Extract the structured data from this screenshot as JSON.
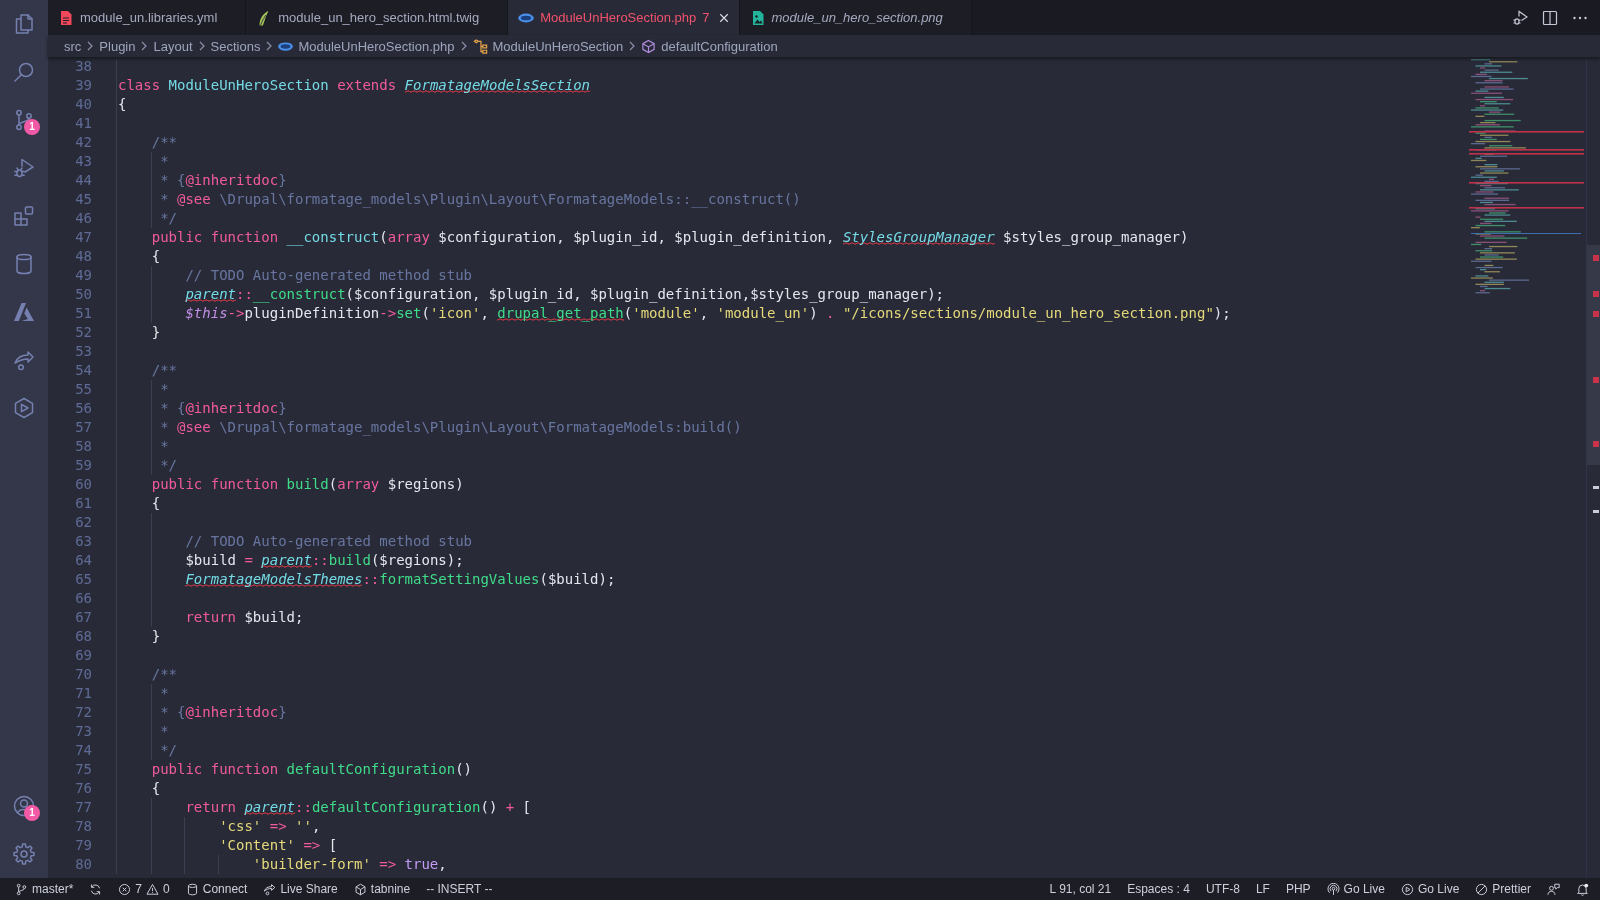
{
  "activity_bar": {
    "items": [
      {
        "kind": "files"
      },
      {
        "kind": "search"
      },
      {
        "kind": "source-control",
        "badge": "1"
      },
      {
        "kind": "run-debug"
      },
      {
        "kind": "extensions"
      },
      {
        "kind": "database"
      },
      {
        "kind": "azure"
      },
      {
        "kind": "live-share"
      },
      {
        "kind": "containers"
      }
    ],
    "bottom_items": [
      {
        "kind": "account",
        "badge": "1"
      },
      {
        "kind": "settings"
      }
    ]
  },
  "tabs": [
    {
      "label": "module_un.libraries.yml",
      "kind": "yaml",
      "selected": false,
      "preview": false
    },
    {
      "label": "module_un_hero_section.html.twig",
      "kind": "twig",
      "selected": false,
      "preview": false
    },
    {
      "label": "ModuleUnHeroSection.php",
      "kind": "php",
      "selected": true,
      "preview": false,
      "problems": "7"
    },
    {
      "label": "module_un_hero_section.png",
      "kind": "image",
      "selected": false,
      "preview": true
    }
  ],
  "breadcrumbs": [
    {
      "label": "src",
      "kind": "folder"
    },
    {
      "label": "Plugin",
      "kind": "folder"
    },
    {
      "label": "Layout",
      "kind": "folder"
    },
    {
      "label": "Sections",
      "kind": "folder"
    },
    {
      "label": "ModuleUnHeroSection.php",
      "kind": "php"
    },
    {
      "label": "ModuleUnHeroSection",
      "kind": "class"
    },
    {
      "label": "defaultConfiguration",
      "kind": "method"
    }
  ],
  "editor": {
    "lines": [
      {
        "number": "38"
      },
      {
        "number": "39",
        "tokens": [
          {
            "text": "class ",
            "kind": "keyword",
            "error": false
          },
          {
            "text": "ModuleUnHeroSection ",
            "kind": "class",
            "error": false
          },
          {
            "text": "extends ",
            "kind": "keyword",
            "error": false
          },
          {
            "text": "FormatageModelsSection",
            "kind": "type",
            "error": true
          }
        ]
      },
      {
        "number": "40",
        "tokens": [
          {
            "text": "{",
            "kind": "plain",
            "error": false
          }
        ]
      },
      {
        "number": "41"
      },
      {
        "number": "42",
        "tokens": [
          {
            "text": "    /**",
            "kind": "comment",
            "error": false
          }
        ]
      },
      {
        "number": "43",
        "tokens": [
          {
            "text": "     *",
            "kind": "comment",
            "error": false
          }
        ]
      },
      {
        "number": "44",
        "tokens": [
          {
            "text": "     * {",
            "kind": "comment",
            "error": false
          },
          {
            "text": "@inheritdoc",
            "kind": "doctag",
            "error": false
          },
          {
            "text": "}",
            "kind": "comment",
            "error": false
          }
        ]
      },
      {
        "number": "45",
        "tokens": [
          {
            "text": "     * ",
            "kind": "comment",
            "error": false
          },
          {
            "text": "@see",
            "kind": "doctag",
            "error": false
          },
          {
            "text": " \\Drupal\\formatage_models\\Plugin\\Layout\\FormatageModels::__construct()",
            "kind": "comment",
            "error": false
          }
        ]
      },
      {
        "number": "46",
        "tokens": [
          {
            "text": "     */",
            "kind": "comment",
            "error": false
          }
        ]
      },
      {
        "number": "47",
        "tokens": [
          {
            "text": "    public function ",
            "kind": "keyword",
            "error": false
          },
          {
            "text": "__construct",
            "kind": "magic",
            "error": false
          },
          {
            "text": "(",
            "kind": "plain",
            "error": false
          },
          {
            "text": "array ",
            "kind": "keyword",
            "error": false
          },
          {
            "text": "$configuration, $plugin_id, $plugin_definition, ",
            "kind": "plain",
            "error": false
          },
          {
            "text": "StylesGroupManager",
            "kind": "type",
            "error": true
          },
          {
            "text": " $styles_group_manager)",
            "kind": "plain",
            "error": false
          }
        ]
      },
      {
        "number": "48",
        "tokens": [
          {
            "text": "    {",
            "kind": "plain",
            "error": false
          }
        ]
      },
      {
        "number": "49",
        "tokens": [
          {
            "text": "        // TODO Auto-generated method stub",
            "kind": "comment",
            "error": false
          }
        ]
      },
      {
        "number": "50",
        "tokens": [
          {
            "text": "        parent",
            "kind": "type",
            "error": true
          },
          {
            "text": "::",
            "kind": "keyword",
            "error": false
          },
          {
            "text": "__construct",
            "kind": "function",
            "error": false
          },
          {
            "text": "($configuration, $plugin_id, $plugin_definition,$styles_group_manager);",
            "kind": "plain",
            "error": false
          }
        ]
      },
      {
        "number": "51",
        "tokens": [
          {
            "text": "        $this",
            "kind": "this",
            "error": false
          },
          {
            "text": "->",
            "kind": "keyword",
            "error": false
          },
          {
            "text": "pluginDefinition",
            "kind": "plain",
            "error": false
          },
          {
            "text": "->",
            "kind": "keyword",
            "error": false
          },
          {
            "text": "set",
            "kind": "function",
            "error": false
          },
          {
            "text": "(",
            "kind": "plain",
            "error": false
          },
          {
            "text": "'icon'",
            "kind": "string",
            "error": false
          },
          {
            "text": ", ",
            "kind": "plain",
            "error": false
          },
          {
            "text": "drupal_get_path",
            "kind": "function",
            "error": true
          },
          {
            "text": "(",
            "kind": "plain",
            "error": false
          },
          {
            "text": "'module'",
            "kind": "string",
            "error": false
          },
          {
            "text": ", ",
            "kind": "plain",
            "error": false
          },
          {
            "text": "'module_un'",
            "kind": "string",
            "error": false
          },
          {
            "text": ") ",
            "kind": "plain",
            "error": false
          },
          {
            "text": ".",
            "kind": "keyword",
            "error": false
          },
          {
            "text": " \"/icons/sections/module_un_hero_section.png\"",
            "kind": "string",
            "error": false
          },
          {
            "text": ");",
            "kind": "plain",
            "error": false
          }
        ]
      },
      {
        "number": "52",
        "tokens": [
          {
            "text": "    }",
            "kind": "plain",
            "error": false
          }
        ]
      },
      {
        "number": "53"
      },
      {
        "number": "54",
        "tokens": [
          {
            "text": "    /**",
            "kind": "comment",
            "error": false
          }
        ]
      },
      {
        "number": "55",
        "tokens": [
          {
            "text": "     *",
            "kind": "comment",
            "error": false
          }
        ]
      },
      {
        "number": "56",
        "tokens": [
          {
            "text": "     * {",
            "kind": "comment",
            "error": false
          },
          {
            "text": "@inheritdoc",
            "kind": "doctag",
            "error": false
          },
          {
            "text": "}",
            "kind": "comment",
            "error": false
          }
        ]
      },
      {
        "number": "57",
        "tokens": [
          {
            "text": "     * ",
            "kind": "comment",
            "error": false
          },
          {
            "text": "@see",
            "kind": "doctag",
            "error": false
          },
          {
            "text": " \\Drupal\\formatage_models\\Plugin\\Layout\\FormatageModels:build()",
            "kind": "comment",
            "error": false
          }
        ]
      },
      {
        "number": "58",
        "tokens": [
          {
            "text": "     *",
            "kind": "comment",
            "error": false
          }
        ]
      },
      {
        "number": "59",
        "tokens": [
          {
            "text": "     */",
            "kind": "comment",
            "error": false
          }
        ]
      },
      {
        "number": "60",
        "tokens": [
          {
            "text": "    public function ",
            "kind": "keyword",
            "error": false
          },
          {
            "text": "build",
            "kind": "function",
            "error": false
          },
          {
            "text": "(",
            "kind": "plain",
            "error": false
          },
          {
            "text": "array ",
            "kind": "keyword",
            "error": false
          },
          {
            "text": "$regions)",
            "kind": "plain",
            "error": false
          }
        ]
      },
      {
        "number": "61",
        "tokens": [
          {
            "text": "    {",
            "kind": "plain",
            "error": false
          }
        ]
      },
      {
        "number": "62"
      },
      {
        "number": "63",
        "tokens": [
          {
            "text": "        // TODO Auto-generated method stub",
            "kind": "comment",
            "error": false
          }
        ]
      },
      {
        "number": "64",
        "tokens": [
          {
            "text": "        $build ",
            "kind": "plain",
            "error": false
          },
          {
            "text": "= ",
            "kind": "keyword",
            "error": false
          },
          {
            "text": "parent",
            "kind": "type",
            "error": true
          },
          {
            "text": "::",
            "kind": "keyword",
            "error": false
          },
          {
            "text": "build",
            "kind": "function",
            "error": false
          },
          {
            "text": "($regions);",
            "kind": "plain",
            "error": false
          }
        ]
      },
      {
        "number": "65",
        "tokens": [
          {
            "text": "        FormatageModelsThemes",
            "kind": "type",
            "error": true
          },
          {
            "text": "::",
            "kind": "keyword",
            "error": false
          },
          {
            "text": "formatSettingValues",
            "kind": "function",
            "error": false
          },
          {
            "text": "($build);",
            "kind": "plain",
            "error": false
          }
        ]
      },
      {
        "number": "66"
      },
      {
        "number": "67",
        "tokens": [
          {
            "text": "        return",
            "kind": "keyword",
            "error": false
          },
          {
            "text": " $build;",
            "kind": "plain",
            "error": false
          }
        ]
      },
      {
        "number": "68",
        "tokens": [
          {
            "text": "    }",
            "kind": "plain",
            "error": false
          }
        ]
      },
      {
        "number": "69"
      },
      {
        "number": "70",
        "tokens": [
          {
            "text": "    /**",
            "kind": "comment",
            "error": false
          }
        ]
      },
      {
        "number": "71",
        "tokens": [
          {
            "text": "     *",
            "kind": "comment",
            "error": false
          }
        ]
      },
      {
        "number": "72",
        "tokens": [
          {
            "text": "     * {",
            "kind": "comment",
            "error": false
          },
          {
            "text": "@inheritdoc",
            "kind": "doctag",
            "error": false
          },
          {
            "text": "}",
            "kind": "comment",
            "error": false
          }
        ]
      },
      {
        "number": "73",
        "tokens": [
          {
            "text": "     *",
            "kind": "comment",
            "error": false
          }
        ]
      },
      {
        "number": "74",
        "tokens": [
          {
            "text": "     */",
            "kind": "comment",
            "error": false
          }
        ]
      },
      {
        "number": "75",
        "tokens": [
          {
            "text": "    public function ",
            "kind": "keyword",
            "error": false
          },
          {
            "text": "defaultConfiguration",
            "kind": "function",
            "error": false
          },
          {
            "text": "()",
            "kind": "plain",
            "error": false
          }
        ]
      },
      {
        "number": "76",
        "tokens": [
          {
            "text": "    {",
            "kind": "plain",
            "error": false
          }
        ]
      },
      {
        "number": "77",
        "tokens": [
          {
            "text": "        return ",
            "kind": "keyword",
            "error": false
          },
          {
            "text": "parent",
            "kind": "type",
            "error": true
          },
          {
            "text": "::",
            "kind": "keyword",
            "error": false
          },
          {
            "text": "defaultConfiguration",
            "kind": "function",
            "error": false
          },
          {
            "text": "() ",
            "kind": "plain",
            "error": false
          },
          {
            "text": "+",
            "kind": "keyword",
            "error": false
          },
          {
            "text": " [",
            "kind": "plain",
            "error": false
          }
        ]
      },
      {
        "number": "78",
        "tokens": [
          {
            "text": "            'css' ",
            "kind": "string",
            "error": false
          },
          {
            "text": "=>",
            "kind": "keyword",
            "error": false
          },
          {
            "text": " ''",
            "kind": "string",
            "error": false
          },
          {
            "text": ",",
            "kind": "plain",
            "error": false
          }
        ]
      },
      {
        "number": "79",
        "tokens": [
          {
            "text": "            'Content' ",
            "kind": "string",
            "error": false
          },
          {
            "text": "=>",
            "kind": "keyword",
            "error": false
          },
          {
            "text": " [",
            "kind": "plain",
            "error": false
          }
        ]
      },
      {
        "number": "80",
        "tokens": [
          {
            "text": "                'builder-form' ",
            "kind": "string",
            "error": false
          },
          {
            "text": "=>",
            "kind": "keyword",
            "error": false
          },
          {
            "text": " true",
            "kind": "constant",
            "error": false
          },
          {
            "text": ",",
            "kind": "plain",
            "error": false
          }
        ]
      }
    ]
  },
  "status_bar": {
    "left": [
      {
        "kind": "branch",
        "text": "master*"
      },
      {
        "kind": "sync"
      },
      {
        "kind": "problems",
        "errors": "7",
        "warnings": "0"
      },
      {
        "kind": "database",
        "text": "Connect"
      },
      {
        "kind": "live-share",
        "text": "Live Share"
      },
      {
        "kind": "tabnine",
        "text": "tabnine"
      },
      {
        "kind": "label",
        "text": "-- INSERT --"
      }
    ],
    "right": [
      {
        "kind": "text",
        "text": "L 91, col 21"
      },
      {
        "kind": "text",
        "text": "Espaces : 4"
      },
      {
        "kind": "text",
        "text": "UTF-8"
      },
      {
        "kind": "text",
        "text": "LF"
      },
      {
        "kind": "text",
        "text": "PHP"
      },
      {
        "kind": "broadcast",
        "text": "Go Live"
      },
      {
        "kind": "play",
        "text": "Go Live"
      },
      {
        "kind": "prettier",
        "text": "Prettier"
      },
      {
        "kind": "feedback"
      },
      {
        "kind": "bell"
      }
    ]
  }
}
